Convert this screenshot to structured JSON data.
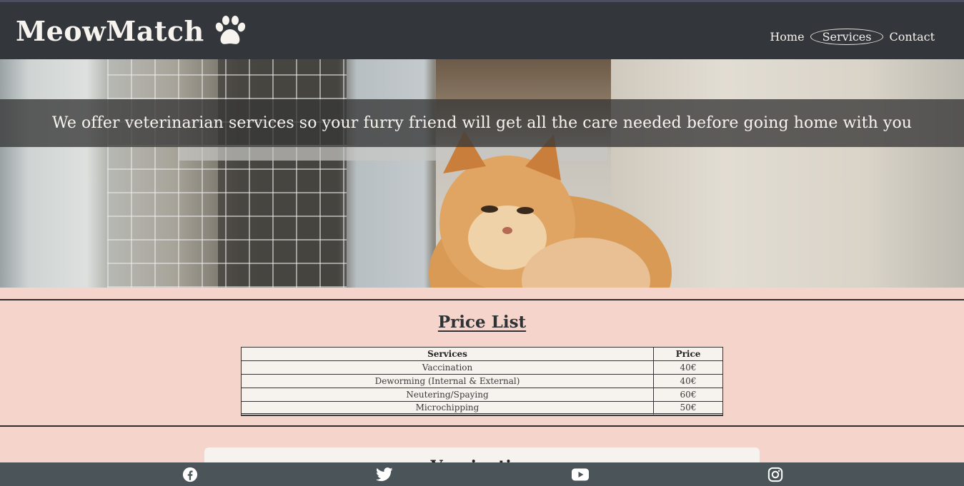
{
  "brand": {
    "name": "MeowMatch",
    "logo_icon": "paw-icon"
  },
  "nav": {
    "items": [
      {
        "label": "Home",
        "active": false
      },
      {
        "label": "Services",
        "active": true
      },
      {
        "label": "Contact",
        "active": false
      }
    ]
  },
  "hero": {
    "text": "We offer veterinarian services so your furry friend will get all the care needed before going home with you"
  },
  "price_list": {
    "title": "Price List",
    "headers": [
      "Services",
      "Price"
    ],
    "rows": [
      {
        "service": "Vaccination",
        "price": "40€"
      },
      {
        "service": "Deworming (Internal & External)",
        "price": "40€"
      },
      {
        "service": "Neutering/Spaying",
        "price": "60€"
      },
      {
        "service": "Microchipping",
        "price": "50€"
      }
    ]
  },
  "next_card": {
    "title": "Vaccination"
  },
  "footer": {
    "icons": [
      "facebook-icon",
      "twitter-icon",
      "youtube-icon",
      "instagram-icon"
    ]
  },
  "colors": {
    "header_bg": "#33373c",
    "page_bg": "#f4d4cb",
    "footer_bg": "#4a5459",
    "text_light": "#f7f3ee"
  }
}
